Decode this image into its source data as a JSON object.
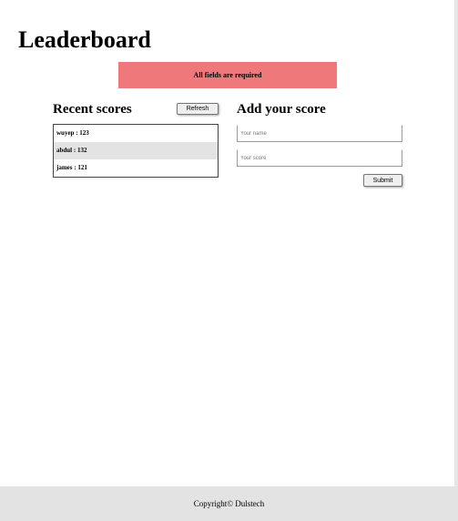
{
  "page": {
    "title": "Leaderboard"
  },
  "alert": {
    "message": "All fields are required",
    "color": "#ef787b"
  },
  "recent": {
    "title": "Recent scores",
    "refresh_label": "Refresh",
    "scores": [
      {
        "text": "wuyep : 123"
      },
      {
        "text": "abdul : 132"
      },
      {
        "text": "james : 121"
      }
    ]
  },
  "form": {
    "title": "Add your score",
    "name_placeholder": "Your name",
    "score_placeholder": "Your score",
    "submit_label": "Submit"
  },
  "footer": {
    "text": "Copyright© Dulstech"
  }
}
